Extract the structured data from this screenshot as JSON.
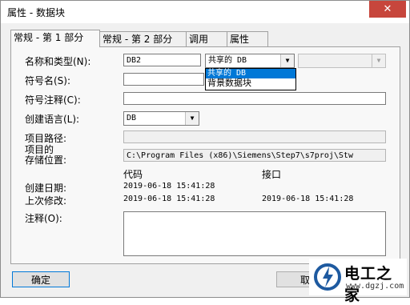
{
  "window": {
    "title": "属性 - 数据块",
    "close_label": "✕"
  },
  "tabs": [
    {
      "label": "常规 - 第 1 部分"
    },
    {
      "label": "常规 - 第 2 部分"
    },
    {
      "label": "调用"
    },
    {
      "label": "属性"
    }
  ],
  "form": {
    "name_type_label": "名称和类型(N):",
    "name_value": "DB2",
    "type_value": "共享的 DB",
    "type_options": [
      "共享的 DB",
      "背景数据块"
    ],
    "symbol_name_label": "符号名(S):",
    "symbol_name_value": "",
    "symbol_comment_label": "符号注释(C):",
    "symbol_comment_value": "",
    "language_label": "创建语言(L):",
    "language_value": "DB",
    "project_path_label": "项目路径:",
    "project_path_value": "",
    "storage_label_line1": "项目的",
    "storage_label_line2": "存储位置:",
    "storage_value": "C:\\Program Files (x86)\\Siemens\\Step7\\s7proj\\Stw",
    "code_header": "代码",
    "interface_header": "接口",
    "created_label": "创建日期:",
    "created_code": "2019-06-18 15:41:28",
    "modified_label": "上次修改:",
    "modified_code": "2019-06-18 15:41:28",
    "modified_interface": "2019-06-18 15:41:28",
    "comment_label": "注释(O):",
    "comment_value": ""
  },
  "buttons": {
    "ok": "确定",
    "cancel_partial": "取"
  },
  "watermark": {
    "title": "电工之家",
    "url": "www.dgzj.com",
    "icon": "electric-logo-icon"
  },
  "colors": {
    "close": "#c7463c",
    "selection": "#0078d7",
    "watermark_blue": "#1e5aa0"
  }
}
